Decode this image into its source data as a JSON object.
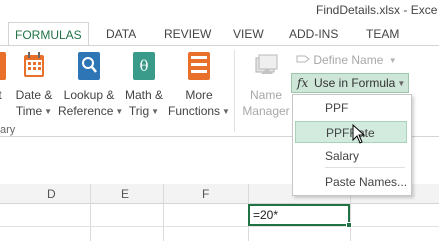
{
  "window": {
    "title": "FindDetails.xlsx - Exce"
  },
  "tabs": [
    {
      "label": "FORMULAS"
    },
    {
      "label": "DATA"
    },
    {
      "label": "REVIEW"
    },
    {
      "label": "VIEW"
    },
    {
      "label": "ADD-INS"
    },
    {
      "label": "TEAM"
    }
  ],
  "ribbon": {
    "buttons": [
      {
        "line1": "t",
        "line2": ""
      },
      {
        "line1": "Date &",
        "line2": "Time"
      },
      {
        "line1": "Lookup &",
        "line2": "Reference"
      },
      {
        "line1": "Math &",
        "line2": "Trig"
      },
      {
        "line1": "More",
        "line2": "Functions"
      },
      {
        "line1": "Name",
        "line2": "Manager"
      }
    ],
    "group_label": "ary",
    "define_name": "Define Name",
    "use_in_formula": "Use in Formula",
    "colors": {
      "accent": "#217346",
      "orange": "#e8702a",
      "blue": "#2e75b6",
      "teal": "#3b9b8a"
    }
  },
  "dropdown": {
    "items": [
      {
        "label": "PPF"
      },
      {
        "label": "PPFRate"
      },
      {
        "label": "Salary"
      },
      {
        "label": "Paste Names..."
      }
    ]
  },
  "sheet": {
    "columns": [
      "D",
      "E",
      "F"
    ],
    "active_cell_value": "=20*"
  }
}
